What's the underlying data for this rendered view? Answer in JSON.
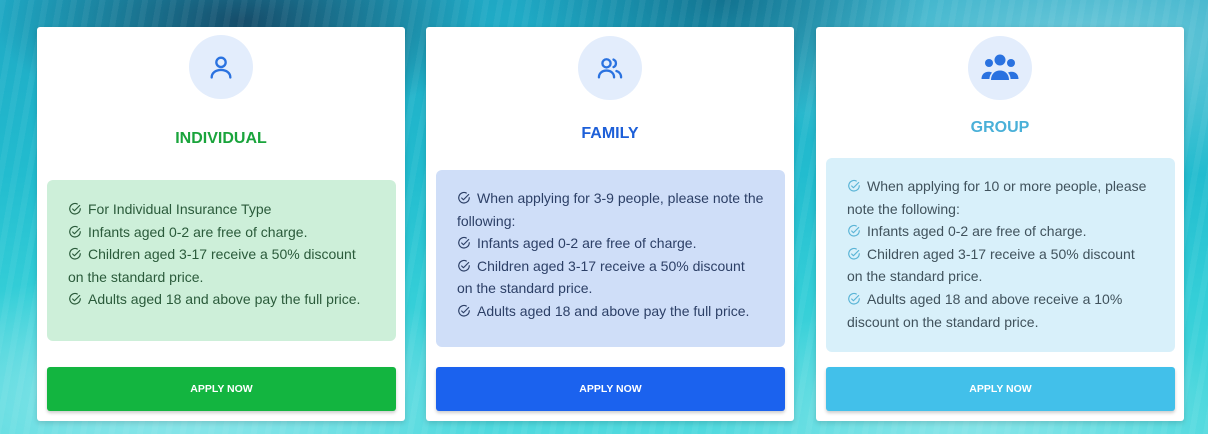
{
  "colors": {
    "individual": "#1aa43c",
    "family": "#1d5fd8",
    "group": "#4ab0d8",
    "icon": "#2a72e0"
  },
  "cards": [
    {
      "icon": "user-icon",
      "title": "INDIVIDUAL",
      "items": [
        "For Individual Insurance Type",
        "Infants aged 0-2 are free of charge.",
        "Children aged 3-17 receive a 50% discount on the standard price.",
        "Adults aged 18 and above pay the full price."
      ],
      "button": "APPLY NOW"
    },
    {
      "icon": "users-icon",
      "title": "FAMILY",
      "items": [
        "When applying for 3-9 people, please note the following:",
        "Infants aged 0-2 are free of charge.",
        "Children aged 3-17 receive a 50% discount on the standard price.",
        "Adults aged 18 and above pay the full price."
      ],
      "button": "APPLY NOW"
    },
    {
      "icon": "group-icon",
      "title": "GROUP",
      "items": [
        "When applying for 10 or more people, please note the following:",
        "Infants aged 0-2 are free of charge.",
        "Children aged 3-17 receive a 50% discount on the standard price.",
        "Adults aged 18 and above receive a 10% discount on the standard price."
      ],
      "button": "APPLY NOW"
    }
  ]
}
